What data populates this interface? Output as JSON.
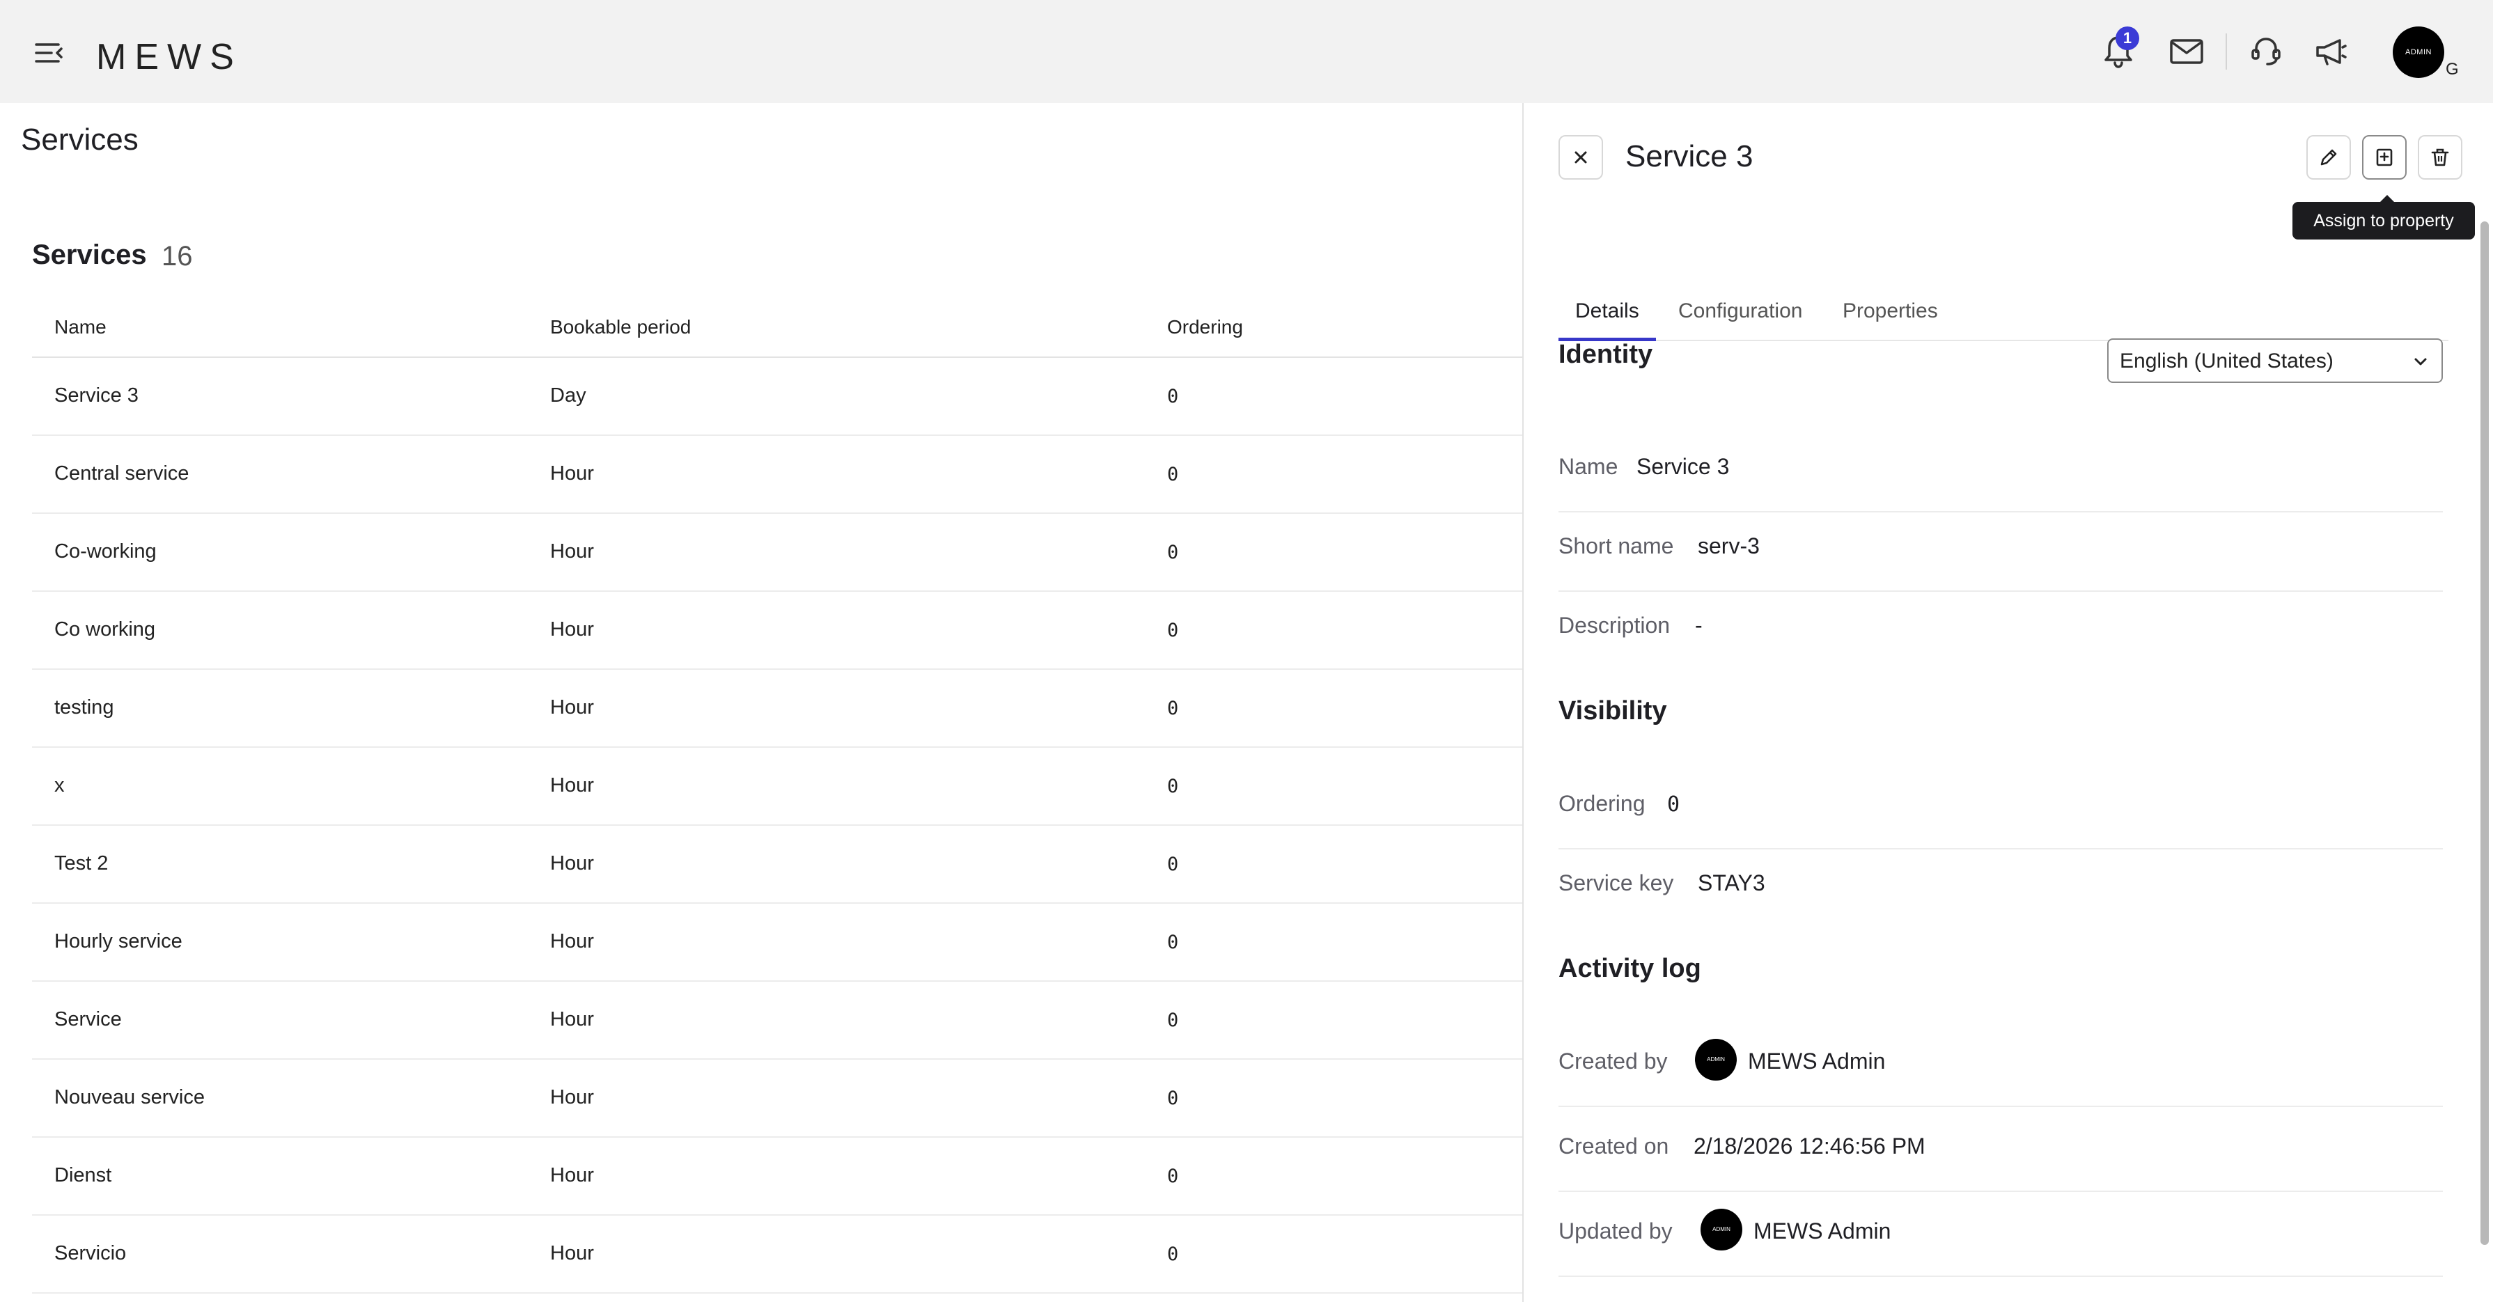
{
  "header": {
    "logo": "MEWS",
    "notification_count": "1",
    "avatar_text": "ADMIN",
    "avatar_suffix": "G"
  },
  "page": {
    "title": "Services"
  },
  "services": {
    "title": "Services",
    "count": "16",
    "columns": [
      "Name",
      "Bookable period",
      "Ordering"
    ],
    "rows": [
      {
        "name": "Service 3",
        "period": "Day",
        "ordering": "0"
      },
      {
        "name": "Central service",
        "period": "Hour",
        "ordering": "0"
      },
      {
        "name": "Co-working",
        "period": "Hour",
        "ordering": "0"
      },
      {
        "name": "Co working",
        "period": "Hour",
        "ordering": "0"
      },
      {
        "name": "testing",
        "period": "Hour",
        "ordering": "0"
      },
      {
        "name": "x",
        "period": "Hour",
        "ordering": "0"
      },
      {
        "name": "Test 2",
        "period": "Hour",
        "ordering": "0"
      },
      {
        "name": "Hourly service",
        "period": "Hour",
        "ordering": "0"
      },
      {
        "name": "Service",
        "period": "Hour",
        "ordering": "0"
      },
      {
        "name": "Nouveau service",
        "period": "Hour",
        "ordering": "0"
      },
      {
        "name": "Dienst",
        "period": "Hour",
        "ordering": "0"
      },
      {
        "name": "Servicio",
        "period": "Hour",
        "ordering": "0"
      }
    ]
  },
  "panel": {
    "title": "Service 3",
    "tooltip": "Assign to property",
    "tabs": [
      "Details",
      "Configuration",
      "Properties"
    ],
    "identity": {
      "heading": "Identity",
      "language": "English (United States)",
      "name_label": "Name",
      "name_value": "Service 3",
      "short_name_label": "Short name",
      "short_name_value": "serv-3",
      "description_label": "Description",
      "description_value": "-"
    },
    "visibility": {
      "heading": "Visibility",
      "ordering_label": "Ordering",
      "ordering_value": "0",
      "service_key_label": "Service key",
      "service_key_value": "STAY3"
    },
    "activity": {
      "heading": "Activity log",
      "created_by_label": "Created by",
      "created_by_value": "MEWS Admin",
      "created_on_label": "Created on",
      "created_on_value": "2/18/2026 12:46:56 PM",
      "updated_by_label": "Updated by",
      "updated_by_value": "MEWS Admin",
      "avatar_text": "ADMIN"
    }
  },
  "colors": {
    "accent": "#3838c9",
    "badge": "#3b3bd6",
    "topbar": "#f2f2f2",
    "tooltip": "#1c1c1f"
  },
  "icons": {
    "menu": "menu-collapse-icon",
    "bell": "bell-icon",
    "mail": "mail-icon",
    "headset": "headset-icon",
    "megaphone": "megaphone-icon",
    "close": "close-icon",
    "edit": "pencil-icon",
    "assign": "assign-to-property-icon",
    "delete": "trash-icon",
    "chevron": "chevron-down-icon"
  }
}
